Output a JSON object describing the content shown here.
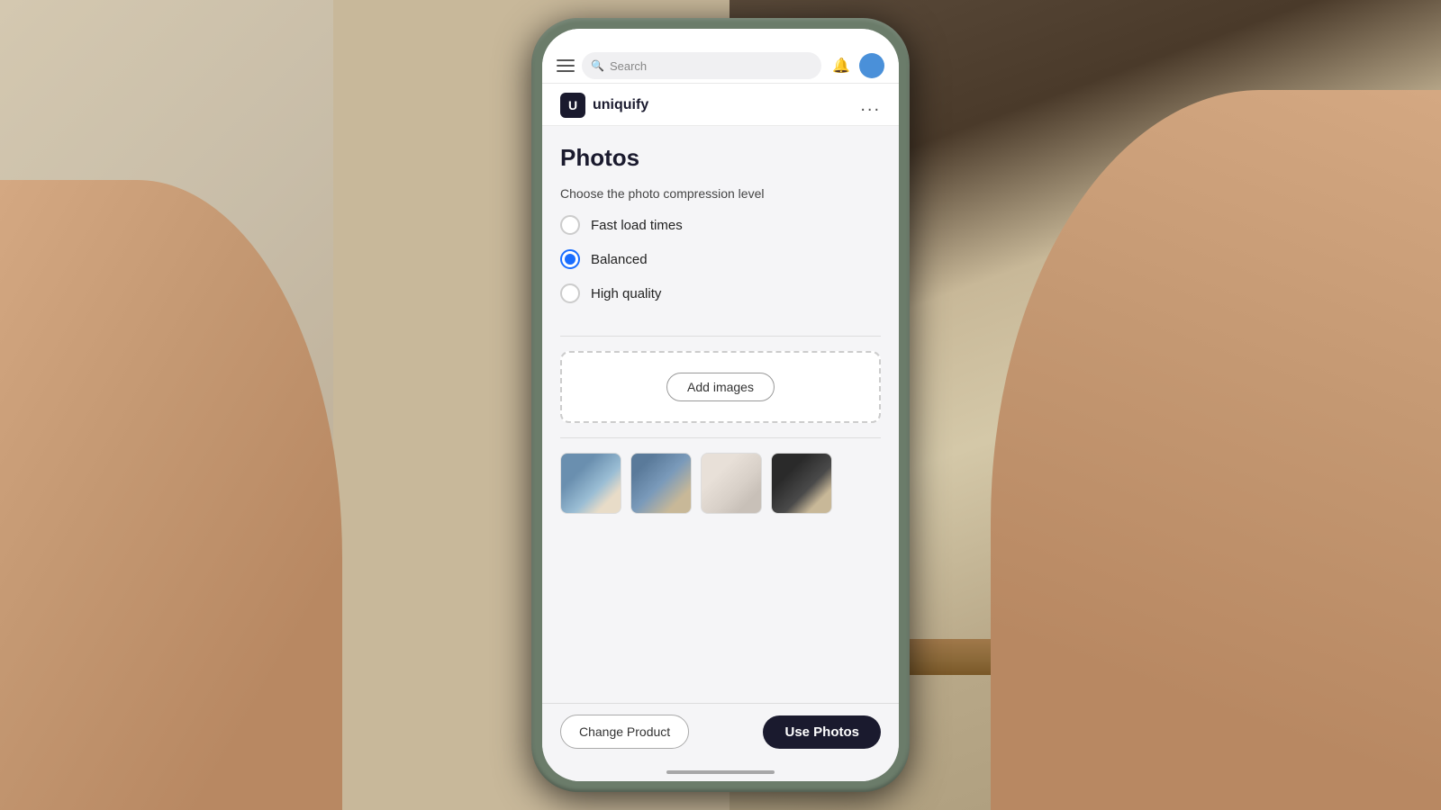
{
  "background": {
    "left_color": "#c8bda8",
    "right_color": "#4a3a2a"
  },
  "topbar": {
    "search_placeholder": "Search",
    "hamburger_label": "Menu"
  },
  "app_header": {
    "logo_text": "U",
    "app_name": "uniquify",
    "more_options_label": "..."
  },
  "page": {
    "title": "Photos",
    "compression_label": "Choose the photo compression level",
    "options": [
      {
        "id": "fast",
        "label": "Fast load times",
        "selected": false
      },
      {
        "id": "balanced",
        "label": "Balanced",
        "selected": true
      },
      {
        "id": "high",
        "label": "High quality",
        "selected": false
      }
    ]
  },
  "upload": {
    "add_images_label": "Add images"
  },
  "thumbnails": [
    {
      "id": 1,
      "alt": "Soap photo 1"
    },
    {
      "id": 2,
      "alt": "Soap photo 2"
    },
    {
      "id": 3,
      "alt": "Soap photo 3"
    },
    {
      "id": 4,
      "alt": "Soap photo 4"
    }
  ],
  "bottom_bar": {
    "change_product_label": "Change Product",
    "use_photos_label": "Use Photos"
  }
}
